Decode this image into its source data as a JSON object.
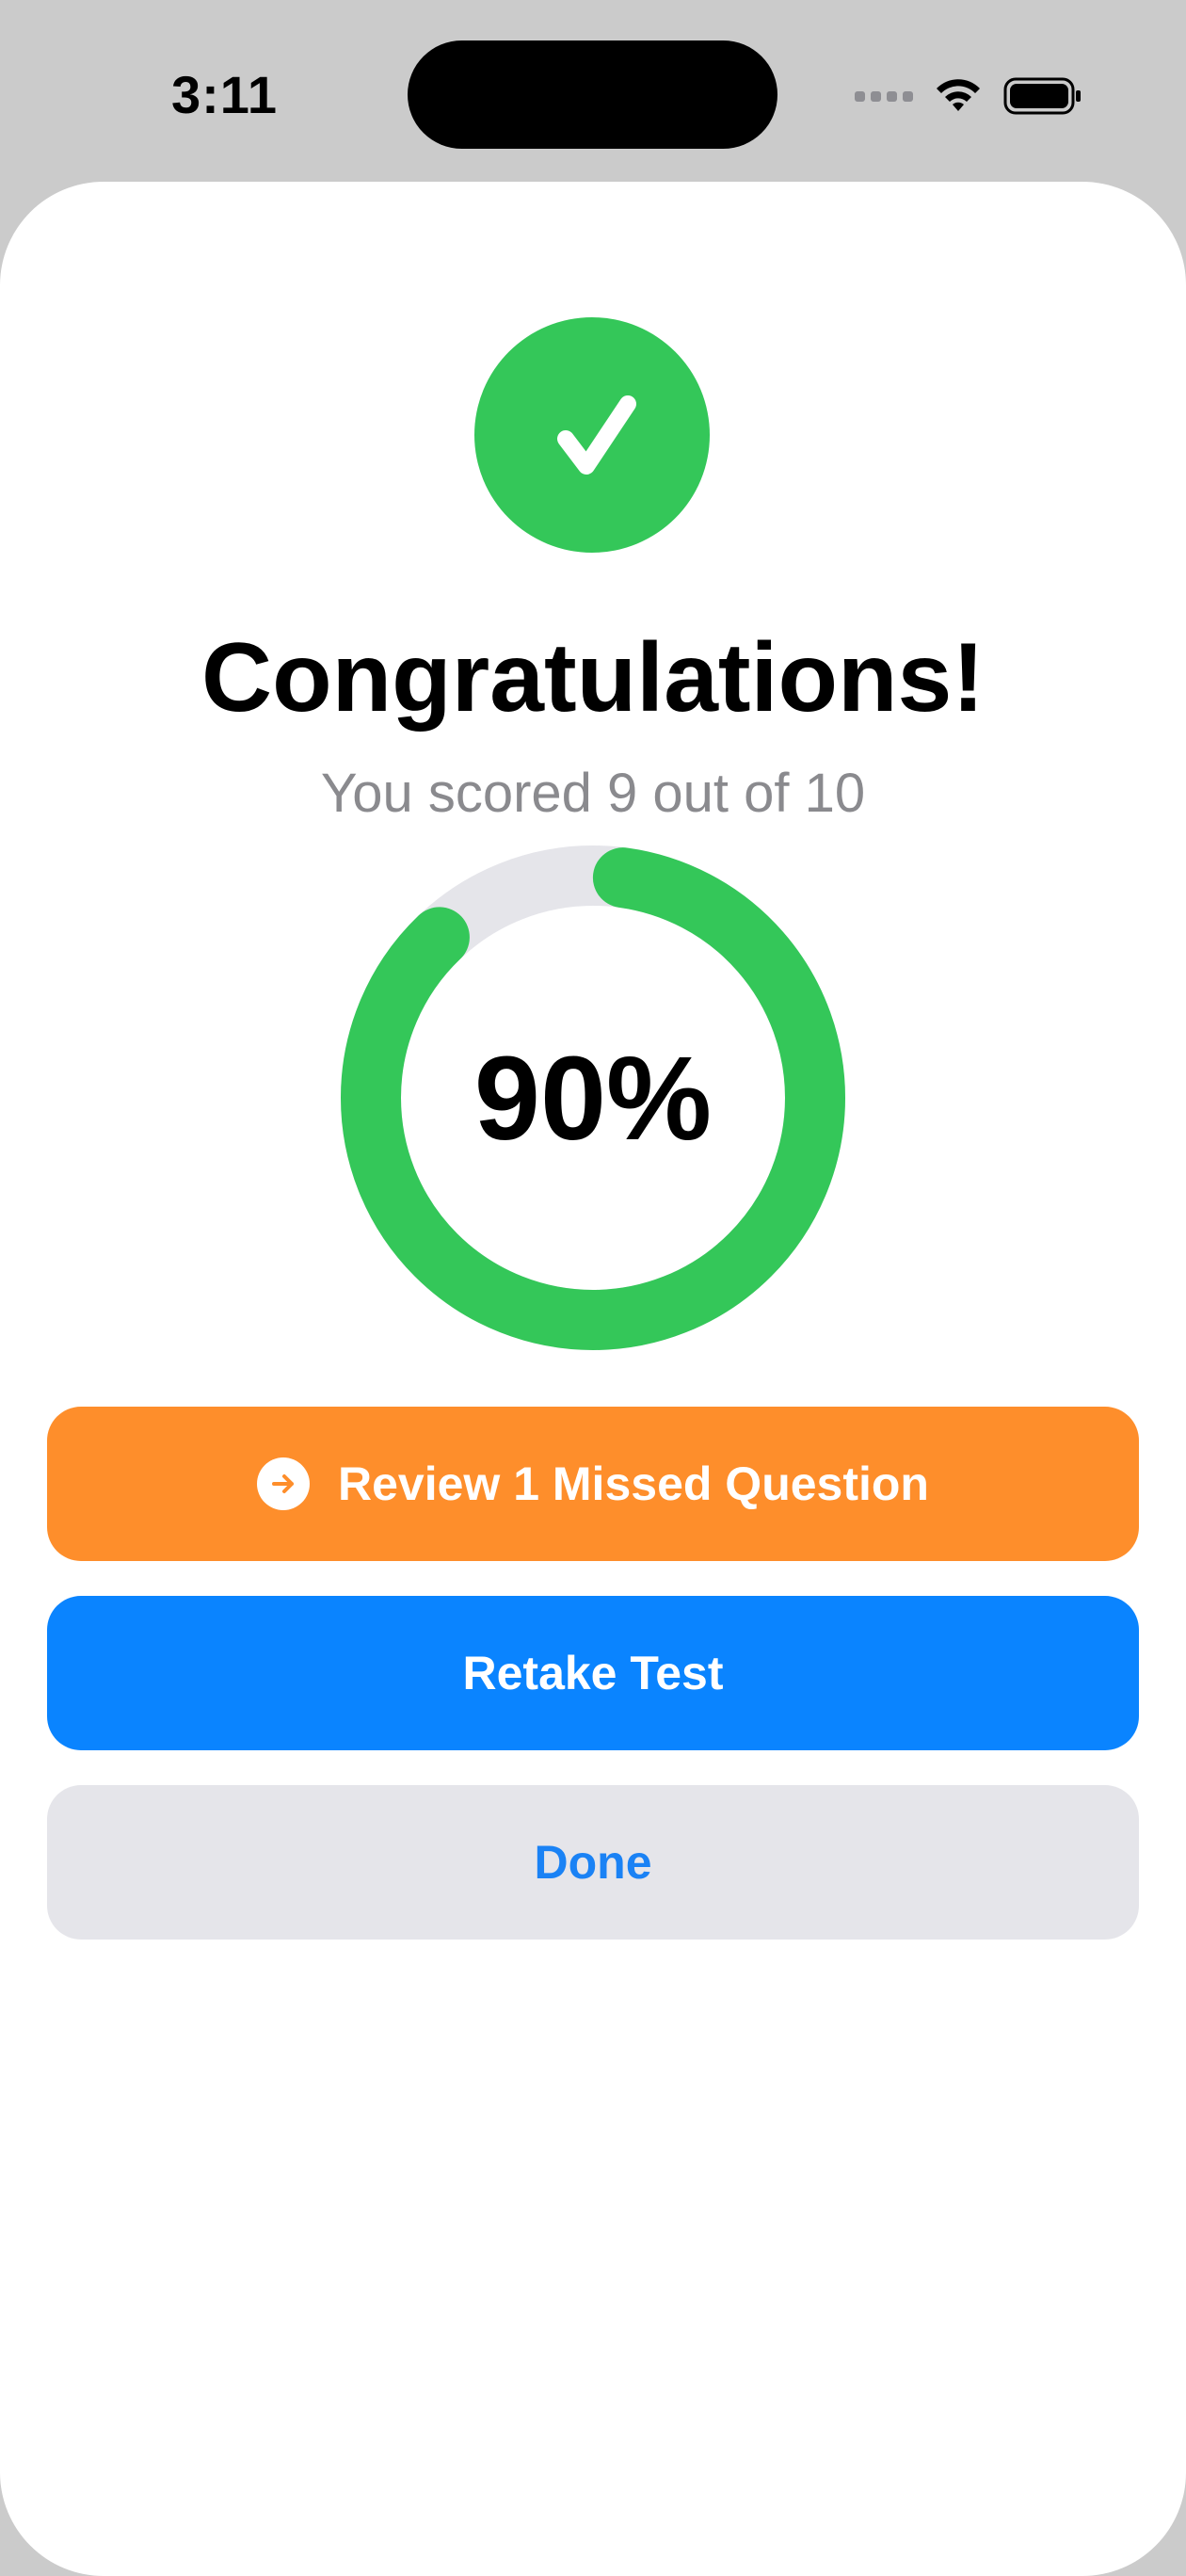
{
  "status_bar": {
    "time": "3:11"
  },
  "result": {
    "title": "Congratulations!",
    "subtitle": "You scored 9 out of 10",
    "percent_label": "90%",
    "score_fraction": 0.9
  },
  "actions": {
    "review_label": "Review 1 Missed Question",
    "retake_label": "Retake Test",
    "done_label": "Done"
  },
  "colors": {
    "success_green": "#34c759",
    "ring_track": "#e5e5ea",
    "review_orange": "#fe8e2b",
    "retake_blue": "#0a84ff",
    "done_gray": "#e5e5ea",
    "done_text_blue": "#1a82f5"
  },
  "icons": {
    "status": [
      "signal-icon",
      "wifi-icon",
      "battery-icon"
    ],
    "success": "checkmark-icon",
    "review": "arrow-right-circle-icon"
  }
}
